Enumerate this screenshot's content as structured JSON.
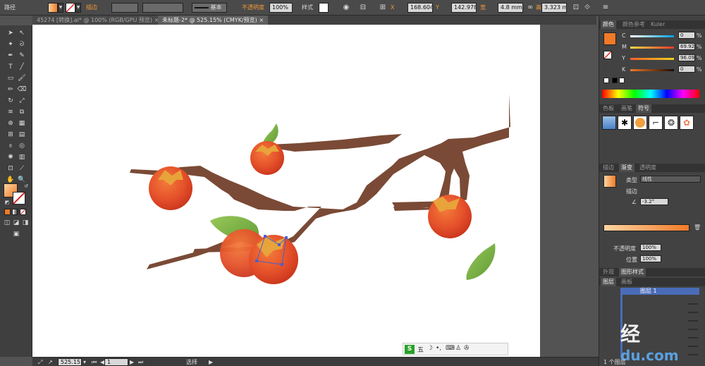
{
  "control_bar": {
    "selection_label": "路径",
    "stroke_label": "描边",
    "stroke_style": "基本",
    "opacity_label": "不透明度",
    "opacity_value": "100%",
    "style_label": "样式",
    "x_label": "X",
    "x_value": "168.604",
    "y_label": "Y",
    "y_value": "142.978",
    "width_label": "宽",
    "width_value": "4.8 mm",
    "height_label": "高",
    "height_value": "3.323 mm"
  },
  "tabs": [
    {
      "label": "45274 [转换].ai* @ 100% (RGB/GPU 预览)"
    },
    {
      "label": "未标题-2* @ 525.15% (CMYK/预览)"
    }
  ],
  "color_panel": {
    "tabs": [
      "颜色",
      "颜色参考",
      "Kuler"
    ],
    "channels": [
      {
        "name": "C",
        "value": "0",
        "unit": "%"
      },
      {
        "name": "M",
        "value": "69.92",
        "unit": "%"
      },
      {
        "name": "Y",
        "value": "96.09",
        "unit": "%"
      },
      {
        "name": "K",
        "value": "0",
        "unit": "%"
      }
    ],
    "fill_color": "#f07a28"
  },
  "swatch_panel": {
    "tabs": [
      "色板",
      "画笔",
      "符号"
    ]
  },
  "gradient_panel": {
    "tabs": [
      "描边",
      "渐变",
      "透明度"
    ],
    "type_label": "类型",
    "type_value": "线性",
    "stroke_label": "描边",
    "angle_value": "-3.2°",
    "opacity_label": "不透明度",
    "opacity_value": "100%",
    "location_label": "位置",
    "location_value": "100%"
  },
  "appearance_tabs": [
    "外观",
    "图形样式"
  ],
  "layers_panel": {
    "tabs": [
      "图层",
      "画板"
    ],
    "layer_name": "图层 1",
    "footer": "1 个图层"
  },
  "status_bar": {
    "zoom": "525.15",
    "page": "1",
    "mode": "选择"
  },
  "ime_bar": {
    "logo": "S",
    "mode": "五"
  },
  "watermark": {
    "text1": "经",
    "text2": "du.com"
  }
}
